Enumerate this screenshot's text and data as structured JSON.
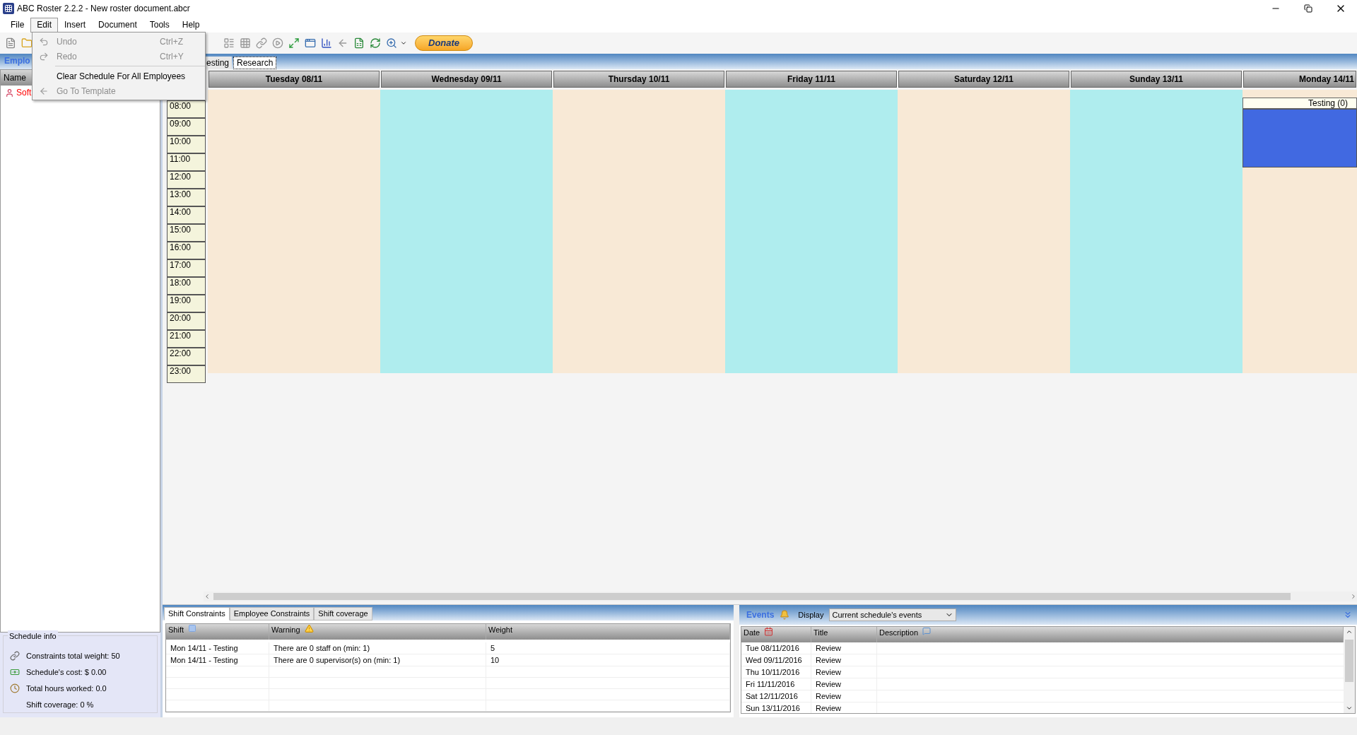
{
  "window": {
    "title": "ABC Roster 2.2.2 - New roster document.abcr"
  },
  "menu": [
    {
      "label": "File",
      "selected": false
    },
    {
      "label": "Edit",
      "selected": true
    },
    {
      "label": "Insert",
      "selected": false
    },
    {
      "label": "Document",
      "selected": false
    },
    {
      "label": "Tools",
      "selected": false
    },
    {
      "label": "Help",
      "selected": false
    }
  ],
  "edit_menu": [
    {
      "kind": "undo",
      "label": "Undo",
      "shortcut": "Ctrl+Z",
      "disabled": true
    },
    {
      "kind": "redo",
      "label": "Redo",
      "shortcut": "Ctrl+Y",
      "disabled": true
    },
    {
      "kind": "separator"
    },
    {
      "kind": "plain",
      "label": "Clear Schedule For All Employees",
      "disabled": false
    },
    {
      "kind": "back",
      "label": "Go To Template",
      "disabled": true
    }
  ],
  "toolbar": {
    "donate": "Donate"
  },
  "left_panel": {
    "tab": "Emplo",
    "column": "Name",
    "employees": [
      {
        "name": "Soft"
      }
    ]
  },
  "schedule_tabs": [
    {
      "label": "esting",
      "selected": false
    },
    {
      "label": "Research",
      "selected": true
    }
  ],
  "times": [
    "08:00",
    "09:00",
    "10:00",
    "11:00",
    "12:00",
    "13:00",
    "14:00",
    "15:00",
    "16:00",
    "17:00",
    "18:00",
    "19:00",
    "20:00",
    "21:00",
    "22:00",
    "23:00"
  ],
  "days": [
    {
      "label": "Tuesday 08/11",
      "color": "#f8e9d6"
    },
    {
      "label": "Wednesday 09/11",
      "color": "#afedee"
    },
    {
      "label": "Thursday 10/11",
      "color": "#f8e9d6"
    },
    {
      "label": "Friday 11/11",
      "color": "#afedee"
    },
    {
      "label": "Saturday 12/11",
      "color": "#f8e9d6"
    },
    {
      "label": "Sunday 13/11",
      "color": "#afedee"
    },
    {
      "label": "Monday 14/11",
      "color": "#f8e9d6",
      "shifts": [
        {
          "label": "Testing (0)",
          "color": "#4169e1"
        }
      ]
    }
  ],
  "schedule_info": {
    "title": "Schedule info",
    "lines": [
      {
        "kind": "link",
        "text": "Constraints total weight: 50"
      },
      {
        "kind": "money",
        "text": "Schedule's cost: $ 0.00"
      },
      {
        "kind": "clock",
        "text": "Total hours worked: 0.0"
      },
      {
        "kind": "none",
        "text": "Shift coverage: 0 %"
      }
    ]
  },
  "constraints": {
    "tabs": [
      {
        "label": "Shift Constraints",
        "selected": true
      },
      {
        "label": "Employee Constraints",
        "selected": false
      },
      {
        "label": "Shift coverage",
        "selected": false
      }
    ],
    "columns": [
      "Shift",
      "Warning",
      "Weight"
    ],
    "rows": [
      [
        "Mon 14/11 - Testing",
        "There are 0 staff on (min: 1)",
        "5"
      ],
      [
        "Mon 14/11 - Testing",
        "There are 0 supervisor(s) on (min: 1)",
        "10"
      ]
    ]
  },
  "events": {
    "title": "Events",
    "display_label": "Display",
    "display_value": "Current schedule's events",
    "columns": [
      "Date",
      "Title",
      "Description"
    ],
    "rows": [
      {
        "date": "Tue 08/11/2016",
        "title": "Review"
      },
      {
        "date": "Wed 09/11/2016",
        "title": "Review"
      },
      {
        "date": "Thu 10/11/2016",
        "title": "Review"
      },
      {
        "date": "Fri 11/11/2016",
        "title": "Review"
      },
      {
        "date": "Sat 12/11/2016",
        "title": "Review"
      },
      {
        "date": "Sun 13/11/2016",
        "title": "Review"
      }
    ]
  }
}
